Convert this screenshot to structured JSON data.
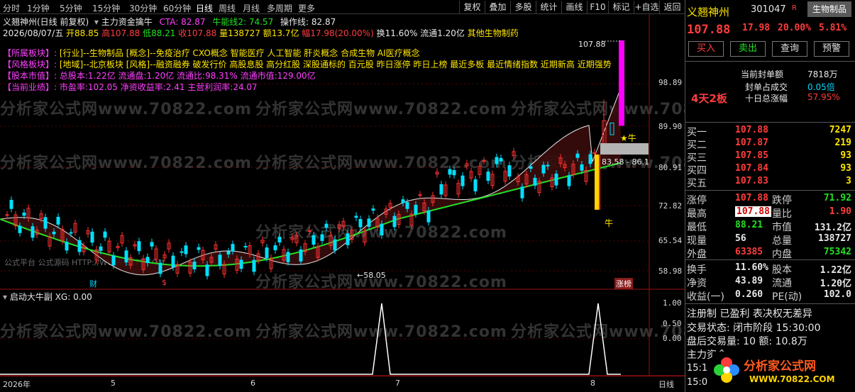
{
  "periods": [
    "分时",
    "1分钟",
    "5分钟",
    "15分钟",
    "30分钟",
    "60分钟",
    "日线",
    "周线",
    "月线",
    "多周期",
    "更多"
  ],
  "active_period": "日线",
  "toolbar": [
    "复权",
    "叠加",
    "多股",
    "统计",
    "画线",
    "F10",
    "标记",
    "+自选",
    "返回"
  ],
  "header": {
    "title_line": "义翘神州(日线 前复权)",
    "indicator_name": "主力资金擒牛",
    "cta": "CTA: 82.87",
    "niuxian": "牛能线2: 74.57",
    "caozuo": "操作线: 82.87"
  },
  "quote_line": {
    "date": "2026/08/07/五",
    "open": "开88.85",
    "high": "高107.88",
    "low": "低88.21",
    "close": "收107.88",
    "volume": "量138727",
    "amount": "额13.7亿",
    "change": "幅17.98(20.00%)",
    "turnover": "换11.60%",
    "float": "流通1.20亿",
    "sector": "其他生物制药"
  },
  "info": {
    "industry_label": "【所属板块】:",
    "industry_value": "[行业]--生物制品 [概念]--免疫治疗 CXO概念 智能医疗 人工智能 肝炎概念 合成生物 AI医疗概念",
    "style_label": "【风格板块】:",
    "style_value": "[地域]--北京板块 [风格]--融资融券 破发行价 高股息股 高分红股 深股通标的 百元股 昨日涨停 昨日上榜 最近多板 最近情绪指数 近期新高 近期强势",
    "cap_label": "【股本市值】:",
    "cap_value": "总股本:1.22亿 流通盘:1.20亿 流通比:98.31% 流通市值:129.00亿",
    "perf_label": "【当前业绩】:",
    "perf_value": "市盈率:102.05 净资收益率:2.41 主营利润率:24.07"
  },
  "y_axis": [
    "98.89",
    "89.90",
    "80.91",
    "72.82",
    "65.54",
    "58.98"
  ],
  "sub_y_axis": [
    "1.00",
    "0.50",
    "0.00"
  ],
  "x_axis": [
    "2026年",
    "5",
    "6",
    "7",
    "8"
  ],
  "annotations": {
    "high_price": "107.88",
    "low_price": "←58.05",
    "range_label": "83.58 - 86.1",
    "bull_star": "★牛",
    "bull_mark": "牛",
    "cai_marker": "财",
    "dollar_marker": "$",
    "zhangbang": "涨榜",
    "watermark_site": "公式平台 公式源码 HTTP://WWW.G8PT.COM",
    "watermark_main": "分析家公式网www.70822.com"
  },
  "sub_indicator": {
    "name": "启动大牛副",
    "value": "XG: 0.00"
  },
  "footer_period": "日线",
  "panel": {
    "name": "义翘神州",
    "code": "301047",
    "r_badge": "R",
    "tag": "生物制品",
    "price": "107.88",
    "change": "17.98",
    "pct": "20.00%",
    "sector_pct": "5.81%",
    "buttons": [
      "买入",
      "卖出",
      "查询",
      "预警"
    ],
    "board_days": "4天2板",
    "seal_rows": [
      {
        "label": "当前封单额",
        "value": "7818万"
      },
      {
        "label": "封单占成交",
        "value": "0.05倍"
      },
      {
        "label": "十日总涨幅",
        "value": "57.95%"
      }
    ],
    "bids": [
      {
        "label": "买一",
        "price": "107.88",
        "vol": "7247"
      },
      {
        "label": "买二",
        "price": "107.87",
        "vol": "219"
      },
      {
        "label": "买三",
        "price": "107.85",
        "vol": "93"
      },
      {
        "label": "买四",
        "price": "107.84",
        "vol": "93"
      },
      {
        "label": "买五",
        "price": "107.83",
        "vol": "3"
      }
    ],
    "stats": [
      {
        "l1": "涨停",
        "v1": "107.88",
        "c1": "red",
        "l2": "跌停",
        "v2": "71.92",
        "c2": "green"
      },
      {
        "l1": "最高",
        "v1": "107.88",
        "c1": "red",
        "l2": "量比",
        "v2": "1.90",
        "c2": "red"
      },
      {
        "l1": "最低",
        "v1": "88.21",
        "c1": "green",
        "l2": "市值",
        "v2": "131.2亿",
        "c2": "white"
      },
      {
        "l1": "现量",
        "v1": "56",
        "c1": "white",
        "l2": "总量",
        "v2": "138727",
        "c2": "white"
      },
      {
        "l1": "外盘",
        "v1": "63385",
        "c1": "red",
        "l2": "内盘",
        "v2": "75342",
        "c2": "green"
      }
    ],
    "fin": [
      {
        "l1": "换手",
        "v1": "11.60%",
        "l2": "股本",
        "v2": "1.22亿"
      },
      {
        "l1": "净资",
        "v1": "43.89",
        "l2": "流通",
        "v2": "1.20亿"
      },
      {
        "l1": "收益(一)",
        "v1": "0.260",
        "l2": "PE(动)",
        "v2": "102.0"
      }
    ],
    "reg_line": "注册制 已盈利 表决权无差异",
    "status_line": "交易状态: 闭市阶段 15:30:00",
    "after_line": "盘后交易量: 10  额: 10.8万",
    "main_line": "主力资金",
    "time1": "15:1",
    "time2": "15:0",
    "logo_text": "分析家公式网",
    "logo_url": "WWW.70822.COM"
  }
}
